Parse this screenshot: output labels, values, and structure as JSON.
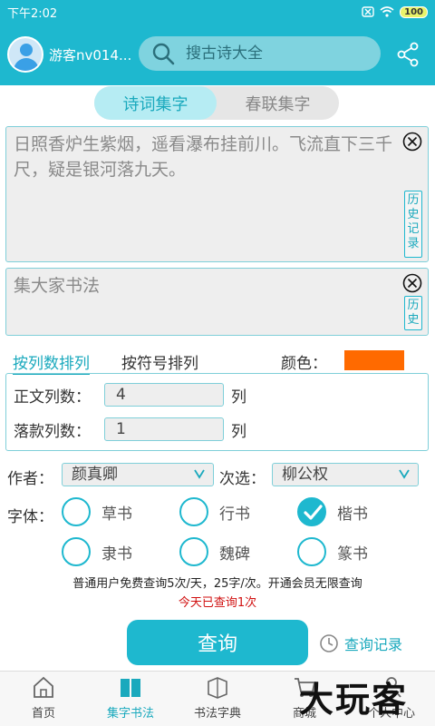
{
  "status": {
    "time": "下午2:02",
    "battery": "100"
  },
  "header": {
    "username": "游客nv014...",
    "search_placeholder": "搜古诗大全"
  },
  "tabs": [
    {
      "label": "诗词集字",
      "active": true
    },
    {
      "label": "春联集字",
      "active": false
    }
  ],
  "poem_input": {
    "value": "日照香炉生紫烟，遥看瀑布挂前川。飞流直下三千尺，疑是银河落九天。",
    "history_label": "历史记录"
  },
  "title_input": {
    "value": "集大家书法",
    "history_label": "历史"
  },
  "sort": {
    "by_column": "按列数排列",
    "by_symbol": "按符号排列",
    "color_label": "颜色：",
    "color": "#ff6a00"
  },
  "columns": {
    "body_label": "正文列数：",
    "body_value": "4",
    "body_unit": "列",
    "sign_label": "落款列数：",
    "sign_value": "1",
    "sign_unit": "列"
  },
  "selectors": {
    "author_label": "作者：",
    "author_value": "颜真卿",
    "alt_label": "次选：",
    "alt_value": "柳公权"
  },
  "fonts": {
    "label": "字体：",
    "options": [
      {
        "label": "草书",
        "checked": false
      },
      {
        "label": "行书",
        "checked": false
      },
      {
        "label": "楷书",
        "checked": true
      },
      {
        "label": "隶书",
        "checked": false
      },
      {
        "label": "魏碑",
        "checked": false
      },
      {
        "label": "篆书",
        "checked": false
      }
    ]
  },
  "notice": {
    "line1": "普通用户免费查询5次/天，25字/次。开通会员无限查询",
    "line2": "今天已查询1次"
  },
  "actions": {
    "query": "查询",
    "query_record": "查询记录"
  },
  "nav": [
    {
      "label": "首页",
      "icon": "home-icon",
      "active": false
    },
    {
      "label": "集字书法",
      "icon": "book-icon",
      "active": true
    },
    {
      "label": "书法字典",
      "icon": "dictionary-icon",
      "active": false
    },
    {
      "label": "商城",
      "icon": "cart-icon",
      "active": false
    },
    {
      "label": "个人中心",
      "icon": "user-icon",
      "active": false
    }
  ],
  "watermark": "大玩客"
}
